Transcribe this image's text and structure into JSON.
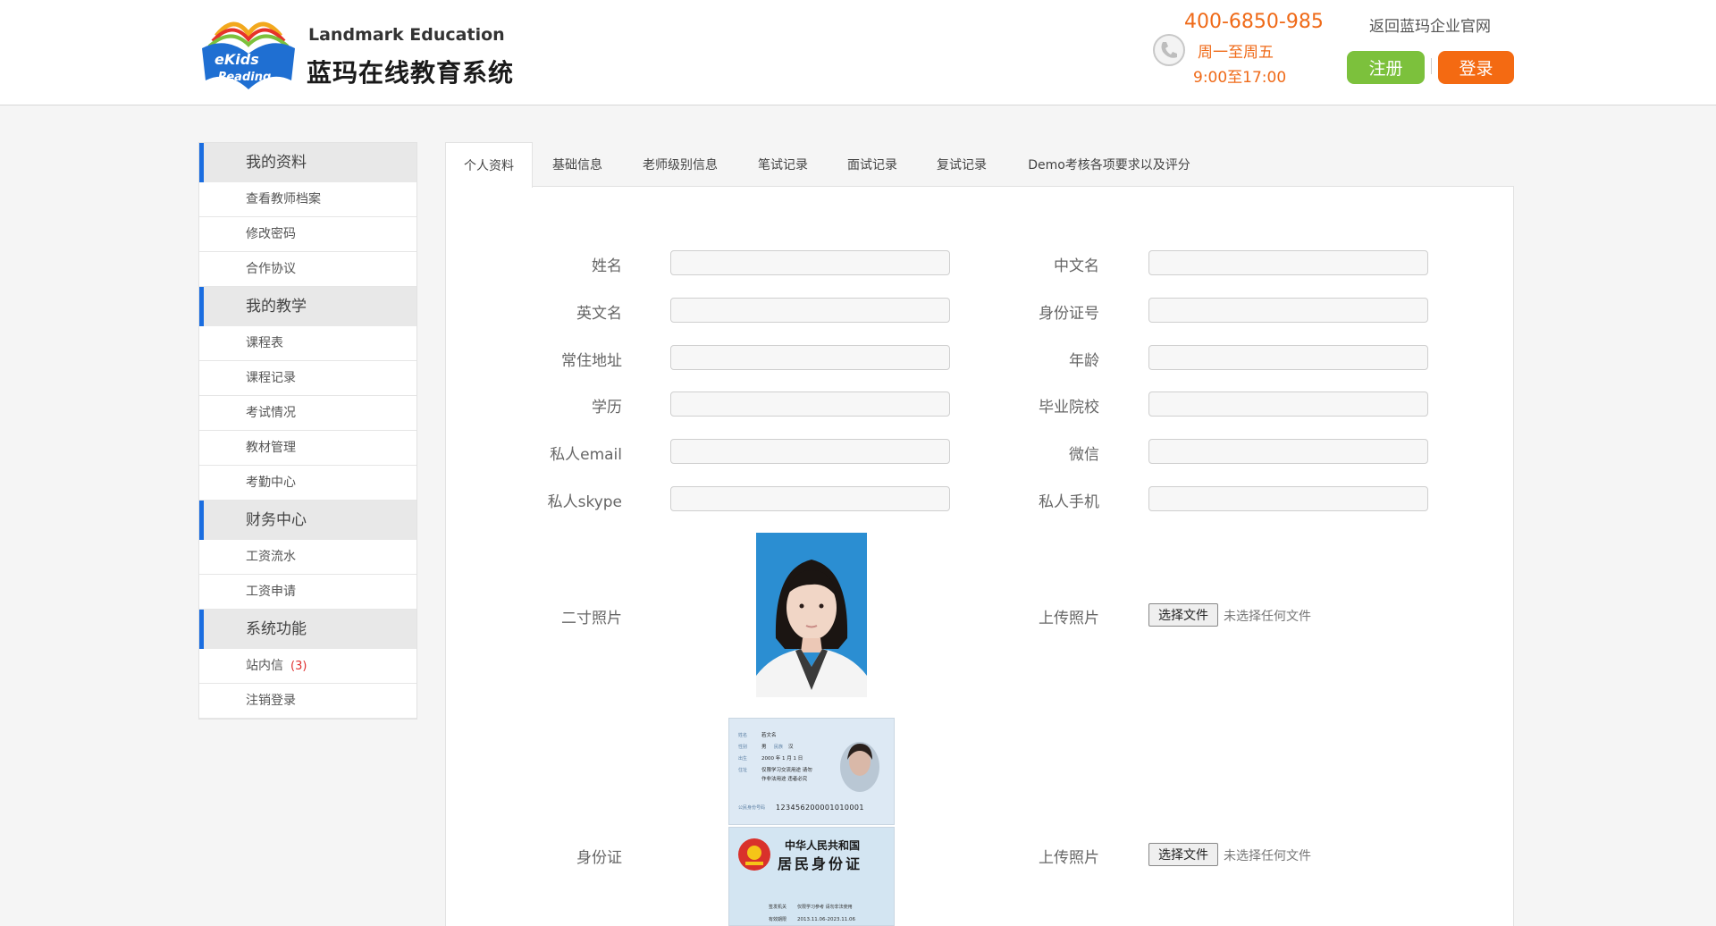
{
  "header": {
    "brand_en": "Landmark Education",
    "brand_cn": "蓝玛在线教育系统",
    "logo_text_top": "eKids",
    "logo_text_bottom": "Reading",
    "phone": "400-6850-985",
    "hours_days": "周一至周五",
    "hours_time": "9:00至17:00",
    "back_link": "返回蓝玛企业官网",
    "register_label": "注册",
    "login_label": "登录",
    "colors": {
      "orange": "#f46a12",
      "green": "#7cc13c",
      "accent_blue": "#1a6de0"
    }
  },
  "sidebar": {
    "groups": [
      {
        "title": "我的资料",
        "items": [
          {
            "label": "查看教师档案"
          },
          {
            "label": "修改密码"
          },
          {
            "label": "合作协议"
          }
        ]
      },
      {
        "title": "我的教学",
        "items": [
          {
            "label": "课程表"
          },
          {
            "label": "课程记录"
          },
          {
            "label": "考试情况"
          },
          {
            "label": "教材管理"
          },
          {
            "label": "考勤中心"
          }
        ]
      },
      {
        "title": "财务中心",
        "items": [
          {
            "label": "工资流水"
          },
          {
            "label": "工资申请"
          }
        ]
      },
      {
        "title": "系统功能",
        "items": [
          {
            "label": "站内信",
            "badge": "(3)"
          },
          {
            "label": "注销登录"
          }
        ]
      }
    ]
  },
  "tabs": [
    {
      "label": "个人资料",
      "active": true
    },
    {
      "label": "基础信息"
    },
    {
      "label": "老师级别信息"
    },
    {
      "label": "笔试记录"
    },
    {
      "label": "面试记录"
    },
    {
      "label": "复试记录"
    },
    {
      "label": "Demo考核各项要求以及评分"
    }
  ],
  "form": {
    "name_label": "姓名",
    "cn_name_label": "中文名",
    "en_name_label": "英文名",
    "id_number_label": "身份证号",
    "address_label": "常住地址",
    "age_label": "年龄",
    "education_label": "学历",
    "school_label": "毕业院校",
    "email_label": "私人email",
    "wechat_label": "微信",
    "skype_label": "私人skype",
    "mobile_label": "私人手机",
    "photo_label": "二寸照片",
    "upload_photo_label": "上传照片",
    "idcard_label": "身份证",
    "upload_idcard_label": "上传照片",
    "file_button": "选择文件",
    "file_none": "未选择任何文件"
  },
  "idcard": {
    "front_name_key": "姓名",
    "front_name_val": "若文名",
    "front_gender_key": "性别",
    "front_gender_val": "男",
    "front_ethnic_key": "民族",
    "front_ethnic_val": "汉",
    "front_birth_key": "出生",
    "front_birth_val": "2000 年 1 月 1 日",
    "front_addr_key": "住址",
    "front_addr_val1": "仅限学习交流用途 请勿",
    "front_addr_val2": "作非法用途 违者必究",
    "front_id_key": "公民身份号码",
    "front_id_val": "123456200001010001",
    "back_title1": "中华人民共和国",
    "back_title2": "居民身份证",
    "back_authority_key": "签发机关",
    "back_authority_val": "仅限学习参考 请勿非法使用",
    "back_valid_key": "有效期限",
    "back_valid_val": "2013.11.06-2023.11.06"
  }
}
